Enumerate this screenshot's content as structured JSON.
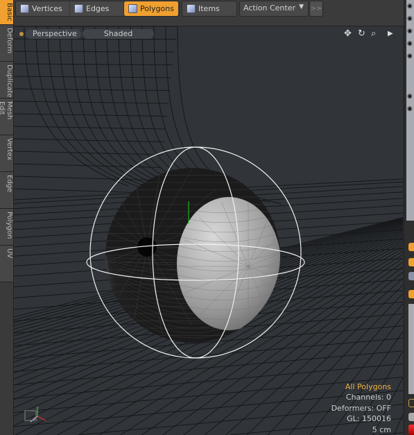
{
  "toolbar": {
    "modes": [
      {
        "label": "Vertices",
        "icon": "vertices-cube-icon",
        "active": false
      },
      {
        "label": "Edges",
        "icon": "edges-cube-icon",
        "active": false
      },
      {
        "label": "Polygons",
        "icon": "polygons-cube-icon",
        "active": true
      },
      {
        "label": "Items",
        "icon": "items-cube-icon",
        "active": false
      }
    ],
    "action_center": "Action Center",
    "more": ">>"
  },
  "left_tabs": [
    "Basic",
    "Deform",
    "Duplicate",
    "Mesh Edit",
    "Vertex",
    "Edge",
    "Polygon",
    "UV"
  ],
  "viewport": {
    "view": "Perspective",
    "shading": "Shaded",
    "nav_icons": [
      "move-icon",
      "rotate-icon",
      "zoom-icon",
      "more-arrow-icon"
    ],
    "info": {
      "selection": "All Polygons",
      "channels": "Channels: 0",
      "deformers": "Deformers: OFF",
      "gl": "GL: 150016",
      "scale": "5 cm"
    }
  },
  "colors": {
    "accent": "#f0a030",
    "viewport_bg": "#31353a"
  }
}
